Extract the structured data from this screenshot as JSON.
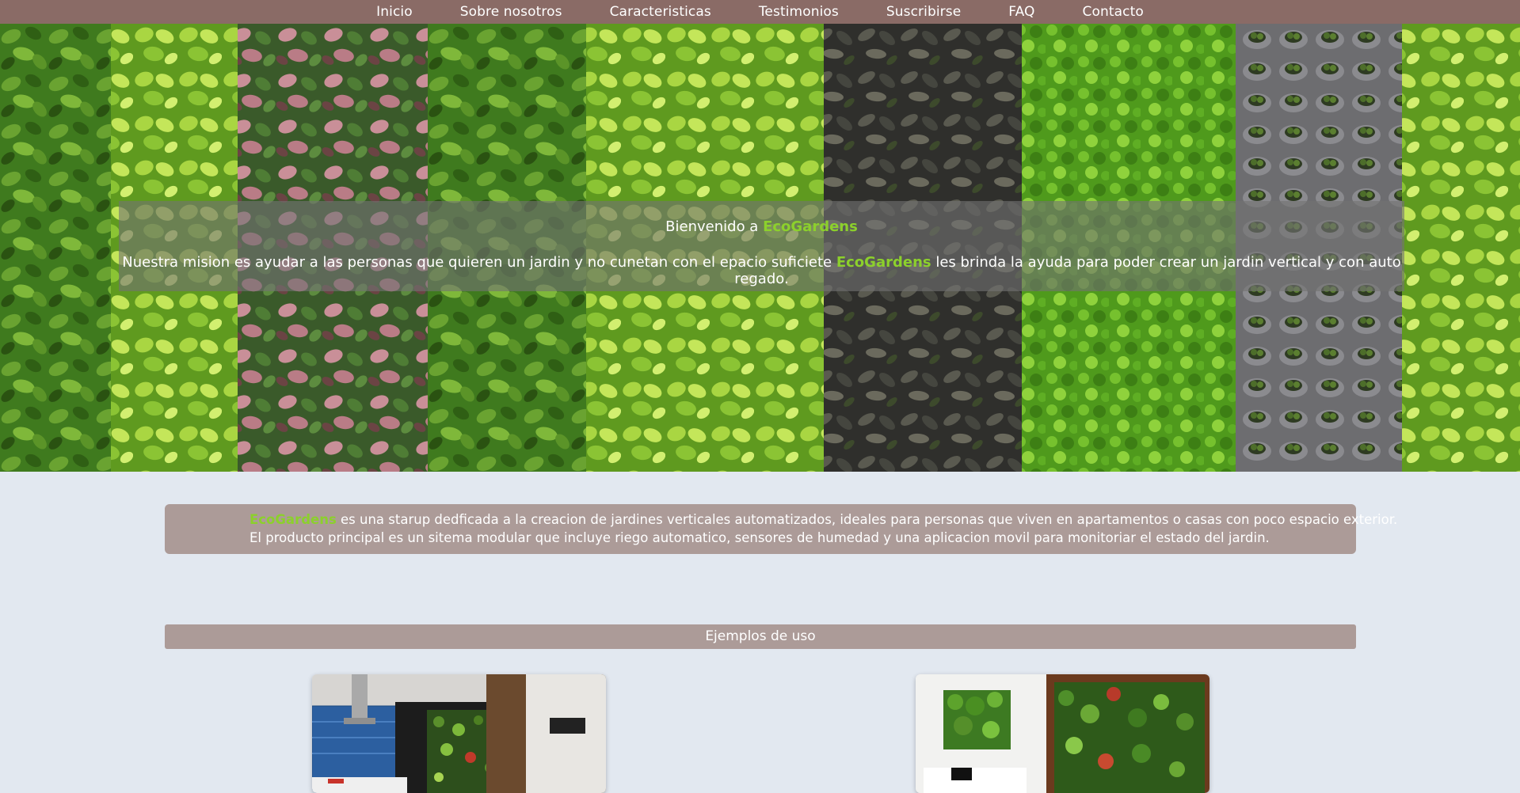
{
  "nav": {
    "items": [
      {
        "label": "Inicio"
      },
      {
        "label": "Sobre nosotros"
      },
      {
        "label": "Caracteristicas"
      },
      {
        "label": "Testimonios"
      },
      {
        "label": "Suscribirse"
      },
      {
        "label": "FAQ"
      },
      {
        "label": "Contacto"
      }
    ]
  },
  "hero": {
    "greeting_prefix": "Bienvenido a ",
    "brand": "EcoGardens",
    "mission_before": "Nuestra mision es ayudar a las personas que quieren un jardin y no cunetan con el epacio suficiete ",
    "mission_after": " les brinda la ayuda para poder crear un jardin vertical y con auto regado."
  },
  "about": {
    "brand": "EcoGardens",
    "line1_rest": " es una starup dedficada a la creacion de jardines verticales automatizados, ideales para personas que viven en apartamentos o casas con poco espacio exterior.",
    "line2": "El producto principal es un sitema modular que incluye riego automatico, sensores de humedad y una aplicacion movil para monitoriar el estado del jardin."
  },
  "examples": {
    "title": "Ejemplos de uso"
  },
  "colors": {
    "nav_bg": "#8a6b66",
    "page_bg": "#e2e8f0",
    "panel_bg": "#ac9b98",
    "accent": "#8cd02c"
  }
}
